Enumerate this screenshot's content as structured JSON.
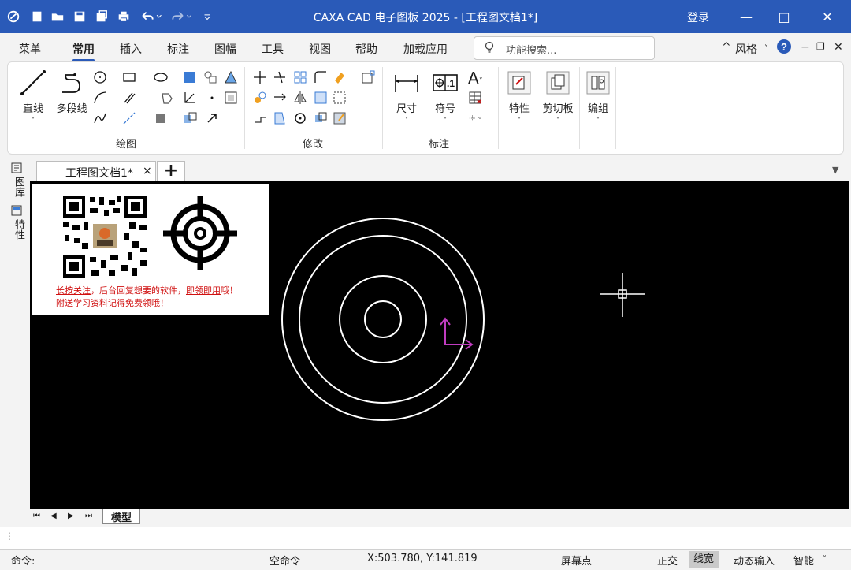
{
  "titlebar": {
    "title": "CAXA CAD 电子图板 2025 - [工程图文档1*]",
    "login": "登录",
    "minimize": "—",
    "maximize": "□",
    "close": "✕",
    "bg_color": "#2a5ab8"
  },
  "menu": {
    "tabs": [
      "菜单",
      "常用",
      "插入",
      "标注",
      "图幅",
      "工具",
      "视图",
      "帮助",
      "加载应用"
    ],
    "active": "常用",
    "search_placeholder": "功能搜索...",
    "style_label": "风格",
    "help": "?"
  },
  "ribbon": {
    "groups": {
      "draw": "绘图",
      "modify": "修改",
      "annotate": "标注"
    },
    "buttons": {
      "line": "直线",
      "polyline": "多段线",
      "dimension": "尺寸",
      "symbol": "符号",
      "properties": "特性",
      "clipboard": "剪切板",
      "group": "编组"
    }
  },
  "side_panel": {
    "items": [
      "图库",
      "特性"
    ]
  },
  "doc_tabs": {
    "active": "工程图文档1*",
    "close": "×",
    "add": "+"
  },
  "overlay": {
    "line1_a": "长按关注",
    "line1_b": "，后台回复想要的软件，",
    "line1_c": "即领即用",
    "line1_d": "哦！",
    "line2": "附送学习资料记得免费领哦！"
  },
  "model_tab": {
    "label": "模型"
  },
  "command": {
    "prompt": "命令:",
    "status": "空命令"
  },
  "statusbar": {
    "coords": "X:503.780, Y:141.819",
    "snap": "屏幕点",
    "ortho": "正交",
    "lineweight": "线宽",
    "dynamic_input": "动态输入",
    "smart": "智能"
  },
  "colors": {
    "accent": "#2a5ab8",
    "canvas": "#000000",
    "ucs": "#c03cc0",
    "overlay_text": "#d01010"
  }
}
